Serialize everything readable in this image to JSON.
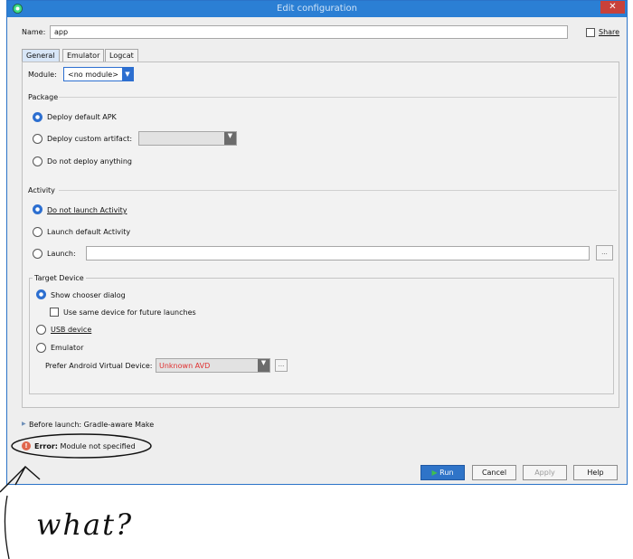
{
  "window": {
    "title": "Edit configuration",
    "close_glyph": "✕"
  },
  "name_field": {
    "label": "Name:",
    "value": "app"
  },
  "share": {
    "label": "Share",
    "checked": false
  },
  "tabs": [
    {
      "label": "General",
      "active": true
    },
    {
      "label": "Emulator",
      "active": false
    },
    {
      "label": "Logcat",
      "active": false
    }
  ],
  "module": {
    "label": "Module:",
    "value": "<no module>"
  },
  "package": {
    "heading": "Package",
    "options": [
      {
        "label": "Deploy default APK",
        "selected": true
      },
      {
        "label": "Deploy custom artifact:",
        "selected": false
      },
      {
        "label": "Do not deploy anything",
        "selected": false
      }
    ]
  },
  "activity": {
    "heading": "Activity",
    "options": [
      {
        "label": "Do not launch Activity",
        "selected": true
      },
      {
        "label": "Launch default Activity",
        "selected": false
      },
      {
        "label": "Launch:",
        "selected": false
      }
    ],
    "browse_label": "..."
  },
  "target_device": {
    "heading": "Target Device",
    "chooser_label": "Show chooser dialog",
    "same_device_label": "Use same device for future launches",
    "usb_label": "USB device",
    "emulator_label": "Emulator",
    "avd_label": "Prefer Android Virtual Device:",
    "avd_value": "Unknown AVD",
    "avd_browse": "..."
  },
  "before_launch": {
    "label": "Before launch: Gradle-aware Make"
  },
  "error": {
    "prefix": "Error:",
    "message": "Module not specified"
  },
  "buttons": {
    "run": "Run",
    "cancel": "Cancel",
    "apply": "Apply",
    "help": "Help"
  },
  "annotation": {
    "text": "what?"
  },
  "colors": {
    "accent": "#2b7fd4",
    "error": "#e03030",
    "run_button": "#2f74c8"
  }
}
